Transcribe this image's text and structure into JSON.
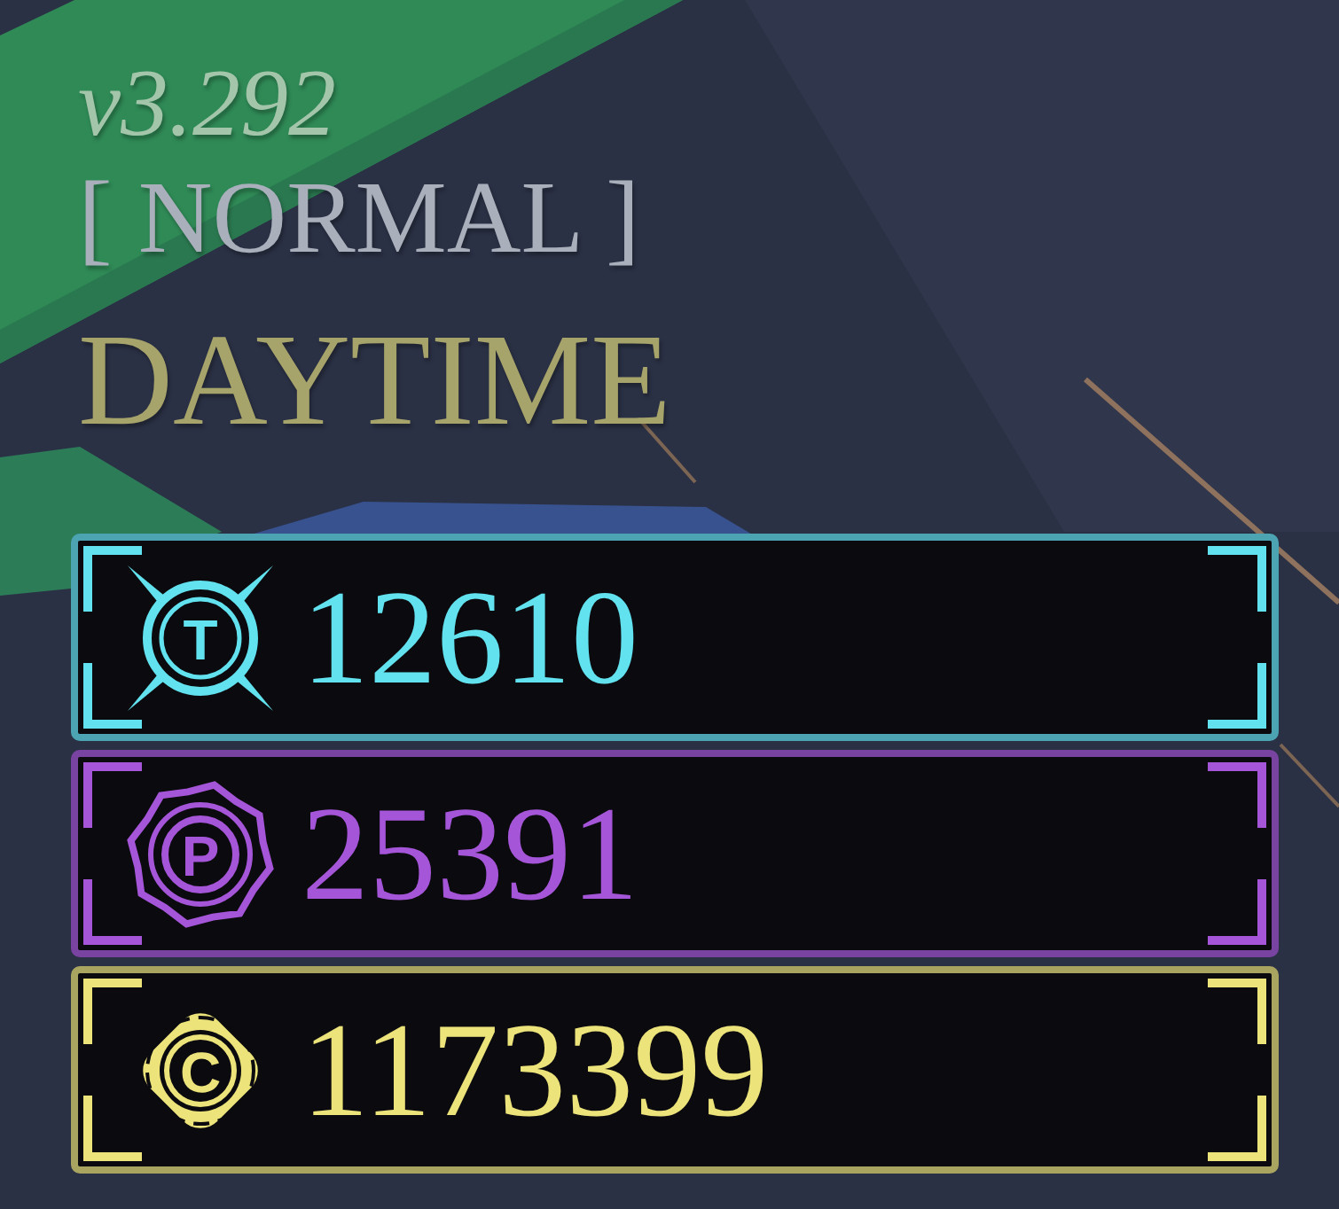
{
  "hud": {
    "version": "v3.292",
    "mode": "[ NORMAL ]",
    "time_of_day": "DAYTIME"
  },
  "currencies": [
    {
      "kind": "token",
      "letter": "T",
      "amount": "12610",
      "color": "#62e2ef"
    },
    {
      "kind": "premium",
      "letter": "P",
      "amount": "25391",
      "color": "#a455d8"
    },
    {
      "kind": "coin",
      "letter": "C",
      "amount": "1173399",
      "color": "#ece37a"
    }
  ]
}
